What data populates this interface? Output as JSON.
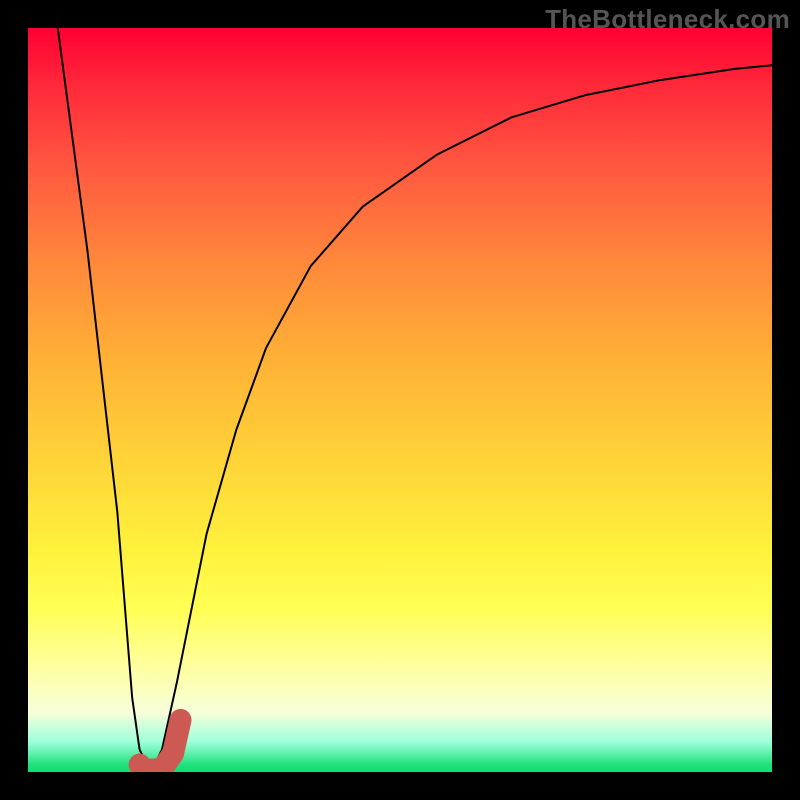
{
  "watermark": "TheBottleneck.com",
  "chart_data": {
    "type": "line",
    "title": "",
    "xlabel": "",
    "ylabel": "",
    "xlim": [
      0,
      100
    ],
    "ylim": [
      0,
      100
    ],
    "series": [
      {
        "name": "bottleneck-curve",
        "x": [
          4,
          8,
          12,
          14,
          15,
          16,
          17,
          18,
          20,
          24,
          28,
          32,
          38,
          45,
          55,
          65,
          75,
          85,
          95,
          100
        ],
        "y": [
          100,
          70,
          35,
          10,
          3,
          1,
          1,
          3,
          12,
          32,
          46,
          57,
          68,
          76,
          83,
          88,
          91,
          93,
          94.5,
          95
        ],
        "stroke": "#000000",
        "stroke_width": 2
      },
      {
        "name": "marker-hook",
        "x": [
          15,
          15.5,
          16.5,
          18,
          19.5,
          20.5
        ],
        "y": [
          1,
          0.4,
          0.3,
          0.4,
          2.5,
          7
        ],
        "stroke": "#cc5a52",
        "stroke_width": 14
      }
    ],
    "background_gradient": {
      "top": "#ff0033",
      "mid1": "#ffb236",
      "mid2": "#fff13c",
      "bottom": "#0be070"
    }
  }
}
